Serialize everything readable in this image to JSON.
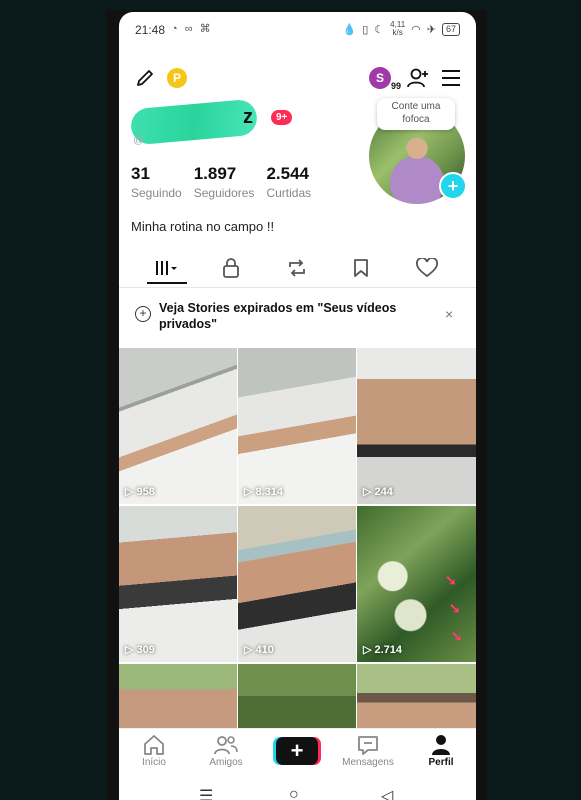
{
  "status": {
    "time": "21:48",
    "speed": "4,11",
    "speed_unit": "k/s",
    "battery": "67"
  },
  "profile": {
    "name_visible_char": "z",
    "notification_badge": "9+",
    "story_bubble": "Conte uma fofoca",
    "stats": [
      {
        "value": "31",
        "label": "Seguindo"
      },
      {
        "value": "1.897",
        "label": "Seguidores"
      },
      {
        "value": "2.544",
        "label": "Curtidas"
      }
    ],
    "bio": "Minha rotina no campo !!",
    "s_badge_letter": "S",
    "s_badge_count": "99"
  },
  "banner": {
    "text": "Veja Stories expirados em \"Seus vídeos privados\"",
    "close": "×"
  },
  "videos": [
    {
      "views": "958"
    },
    {
      "views": "8.314"
    },
    {
      "views": "244"
    },
    {
      "views": "309"
    },
    {
      "views": "410"
    },
    {
      "views": "2.714"
    }
  ],
  "nav": {
    "inicio": "Início",
    "amigos": "Amigos",
    "create": "+",
    "mensagens": "Mensagens",
    "perfil": "Perfil"
  },
  "colors": {
    "accent_red": "#fe2c55",
    "accent_cyan": "#20d5ec",
    "coin": "#f5c518"
  }
}
